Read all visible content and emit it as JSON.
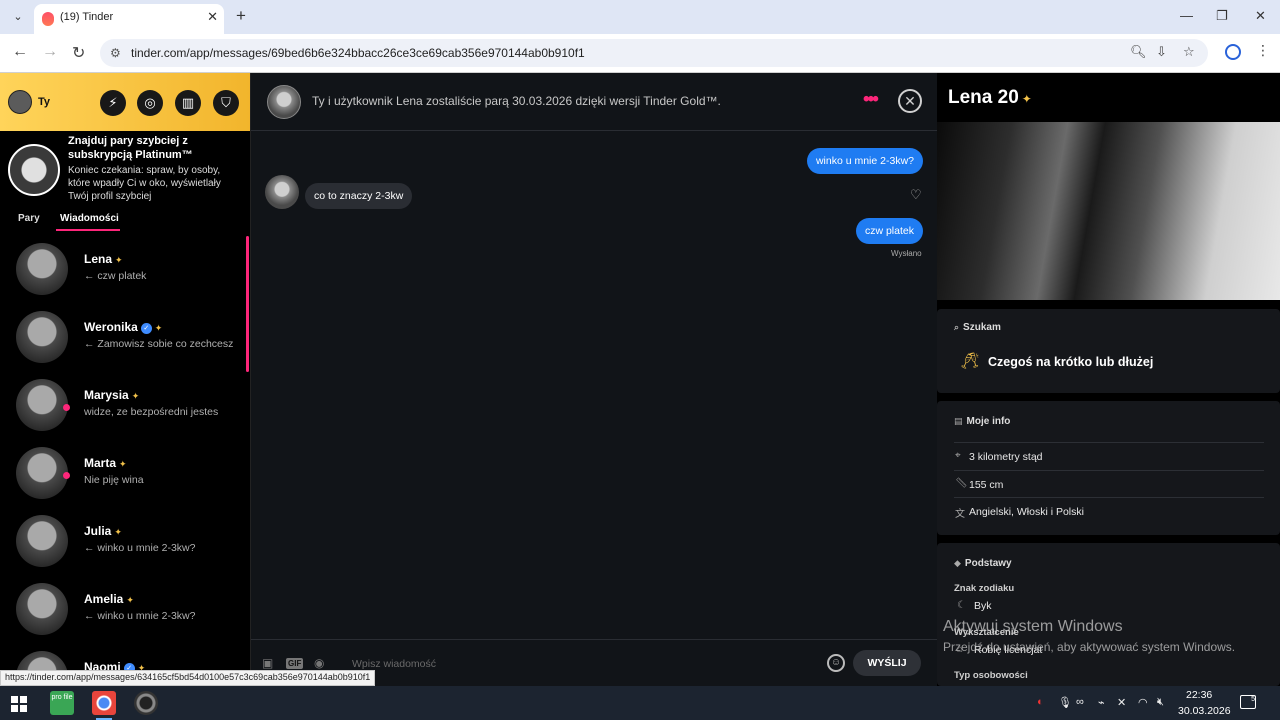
{
  "browser": {
    "tab_title": "(19) Tinder",
    "url": "tinder.com/app/messages/69bed6b6e324bbacc26ce3ce69cab356e970144ab0b910f1"
  },
  "sidebar": {
    "me_label": "Ty",
    "promo": {
      "title": "Znajduj pary szybciej z subskrypcją Platinum™",
      "desc": "Koniec czekania: spraw, by osoby, które wpadły Ci w oko, wyświetlały Twój profil szybciej"
    },
    "tabs": [
      "Pary",
      "Wiadomości"
    ],
    "conversations": [
      {
        "name": "Lena",
        "last": "← czw platek",
        "verified": false,
        "online": false
      },
      {
        "name": "Weronika",
        "last": "← Zamowisz sobie co zechcesz",
        "verified": true,
        "online": false
      },
      {
        "name": "Marysia",
        "last": "widze, ze bezpośredni jestes",
        "verified": false,
        "online": true
      },
      {
        "name": "Marta",
        "last": "Nie piję wina",
        "verified": false,
        "online": true
      },
      {
        "name": "Julia",
        "last": "← winko u mnie 2-3kw?",
        "verified": false,
        "online": false
      },
      {
        "name": "Amelia",
        "last": "← winko u mnie 2-3kw?",
        "verified": false,
        "online": false
      },
      {
        "name": "Naomi",
        "last": "",
        "verified": true,
        "online": false
      }
    ]
  },
  "chat": {
    "header_text": "Ty i użytkownik Lena zostaliście parą 30.03.2026 dzięki wersji Tinder Gold™.",
    "messages": [
      {
        "dir": "out",
        "text": "winko u mnie 2-3kw?"
      },
      {
        "dir": "in",
        "text": "co to znaczy 2-3kw"
      },
      {
        "dir": "out",
        "text": "czw platek"
      }
    ],
    "sent_status": "Wysłano",
    "input_placeholder": "Wpisz wiadomość",
    "send_label": "WYŚLIJ"
  },
  "profile": {
    "name_age": "Lena 20",
    "looking_for_title": "Szukam",
    "looking_for_value": "Czegoś na krótko lub dłużej",
    "my_info_title": "Moje info",
    "info_rows": [
      "3 kilometry stąd",
      "155 cm",
      "Angielski, Włoski i Polski"
    ],
    "basics_title": "Podstawy",
    "zodiac_label": "Znak zodiaku",
    "zodiac_value": "Byk",
    "education_label": "Wykształcenie",
    "education_value": "Robię licencjat",
    "personality_label": "Typ osobowości"
  },
  "watermark": {
    "line1": "Aktywuj system Windows",
    "line2": "Przejdź do ustawień, aby aktywować system Windows."
  },
  "status_url": "https://tinder.com/app/messages/634165cf5bd54d0100e57c3c69cab356e970144ab0b910f1",
  "taskbar": {
    "time": "22:36",
    "date": "30.03.2026",
    "notif_count": "5",
    "app_label": "pro file"
  },
  "colors": {
    "accent_pink": "#fd267a",
    "bubble_blue": "#1f7cf2",
    "gold": "#f2c14a"
  }
}
